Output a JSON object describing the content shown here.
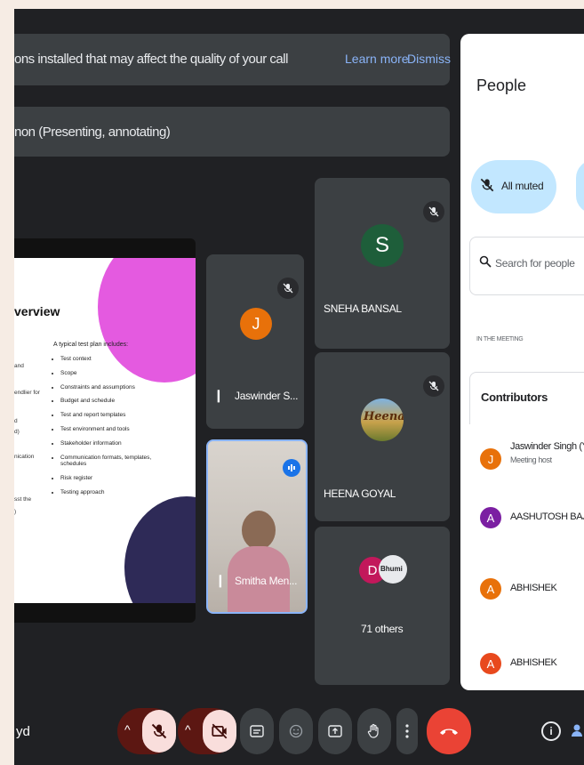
{
  "banner": {
    "message": "ons installed that may affect the quality of your call",
    "learn_more": "Learn more",
    "dismiss": "Dismiss"
  },
  "presenting": {
    "label": "non (Presenting, annotating)"
  },
  "slide": {
    "title": "verview",
    "intro": "A typical test plan includes:",
    "bullets": [
      "Test context",
      "Scope",
      "Constraints and assumptions",
      "Budget and schedule",
      "Test and report templates",
      "Test environment and tools",
      "Stakeholder information",
      "Communication formats, templates, schedules",
      "Risk register",
      "Testing approach"
    ],
    "left_fragments": [
      "and",
      "endlier for",
      "d",
      "d)",
      "nication",
      "sst the",
      ")"
    ]
  },
  "tiles": {
    "sneha": {
      "initial": "S",
      "name": "SNEHA BANSAL",
      "color": "#1e5e3a"
    },
    "jaswinder": {
      "initial": "J",
      "name": "Jaswinder S...",
      "color": "#e8710a"
    },
    "heena": {
      "name": "HEENA GOYAL",
      "avatar_text": "Heena"
    },
    "smitha": {
      "name": "Smitha Men..."
    },
    "others": {
      "initial_d": "D",
      "bhumi_text": "Bhumi",
      "label": "71 others",
      "color_d": "#c2185b"
    }
  },
  "toolbar": {
    "meeting_code": "yd",
    "chevron": "^",
    "info_glyph": "i"
  },
  "people_panel": {
    "title": "People",
    "all_muted": "All muted",
    "search_placeholder": "Search for people",
    "section_label": "IN THE MEETING",
    "contributors": "Contributors",
    "people": [
      {
        "initial": "J",
        "name": "Jaswinder Singh (Y",
        "sub": "Meeting host",
        "color": "#e8710a"
      },
      {
        "initial": "A",
        "name": "AASHUTOSH BAJA",
        "color": "#7b1fa2"
      },
      {
        "initial": "A",
        "name": "ABHISHEK",
        "color": "#e8710a"
      },
      {
        "initial": "A",
        "name": "ABHISHEK",
        "color": "#e8491d"
      }
    ]
  }
}
